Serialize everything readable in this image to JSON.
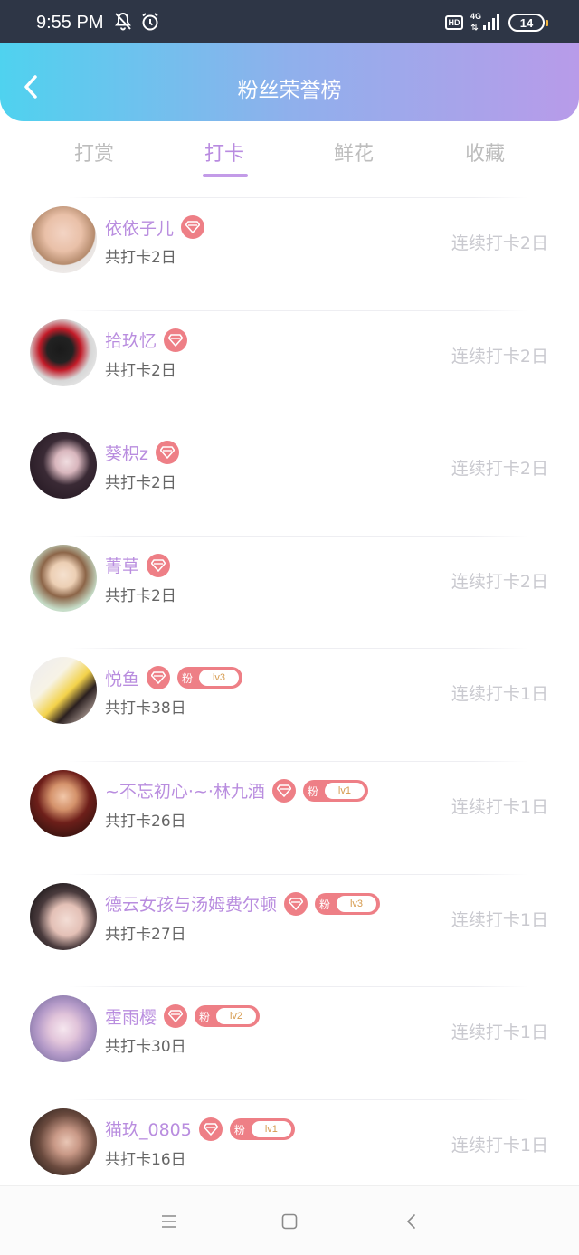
{
  "status_bar": {
    "time": "9:55 PM",
    "hd": "HD",
    "network": "4G",
    "battery": "14"
  },
  "header": {
    "title": "粉丝荣誉榜"
  },
  "tabs": [
    {
      "label": "打赏",
      "active": false
    },
    {
      "label": "打卡",
      "active": true
    },
    {
      "label": "鲜花",
      "active": false
    },
    {
      "label": "收藏",
      "active": false
    }
  ],
  "fans": [
    {
      "name": "依依子儿",
      "total": "共打卡2日",
      "streak": "连续打卡2日",
      "fan_badge": "",
      "fan_level": ""
    },
    {
      "name": "拾玖忆",
      "total": "共打卡2日",
      "streak": "连续打卡2日",
      "fan_badge": "",
      "fan_level": ""
    },
    {
      "name": "葵枳z",
      "total": "共打卡2日",
      "streak": "连续打卡2日",
      "fan_badge": "",
      "fan_level": ""
    },
    {
      "name": "菁草",
      "total": "共打卡2日",
      "streak": "连续打卡2日",
      "fan_badge": "",
      "fan_level": ""
    },
    {
      "name": "悦鱼",
      "total": "共打卡38日",
      "streak": "连续打卡1日",
      "fan_badge": "粉",
      "fan_level": "lv3"
    },
    {
      "name": "~不忘初心·~·林九酒",
      "total": "共打卡26日",
      "streak": "连续打卡1日",
      "fan_badge": "粉",
      "fan_level": "lv1"
    },
    {
      "name": "德云女孩与汤姆费尔顿",
      "total": "共打卡27日",
      "streak": "连续打卡1日",
      "fan_badge": "粉",
      "fan_level": "lv3"
    },
    {
      "name": "霍雨樱",
      "total": "共打卡30日",
      "streak": "连续打卡1日",
      "fan_badge": "粉",
      "fan_level": "lv2"
    },
    {
      "name": "猫玖_0805",
      "total": "共打卡16日",
      "streak": "连续打卡1日",
      "fan_badge": "粉",
      "fan_level": "lv1"
    }
  ],
  "colors": {
    "header_gradient_start": "#4fd2ef",
    "header_gradient_end": "#b89be9",
    "name_purple": "#b98ddf",
    "badge_pink": "#ee7f86",
    "tab_active": "#b98be0"
  }
}
